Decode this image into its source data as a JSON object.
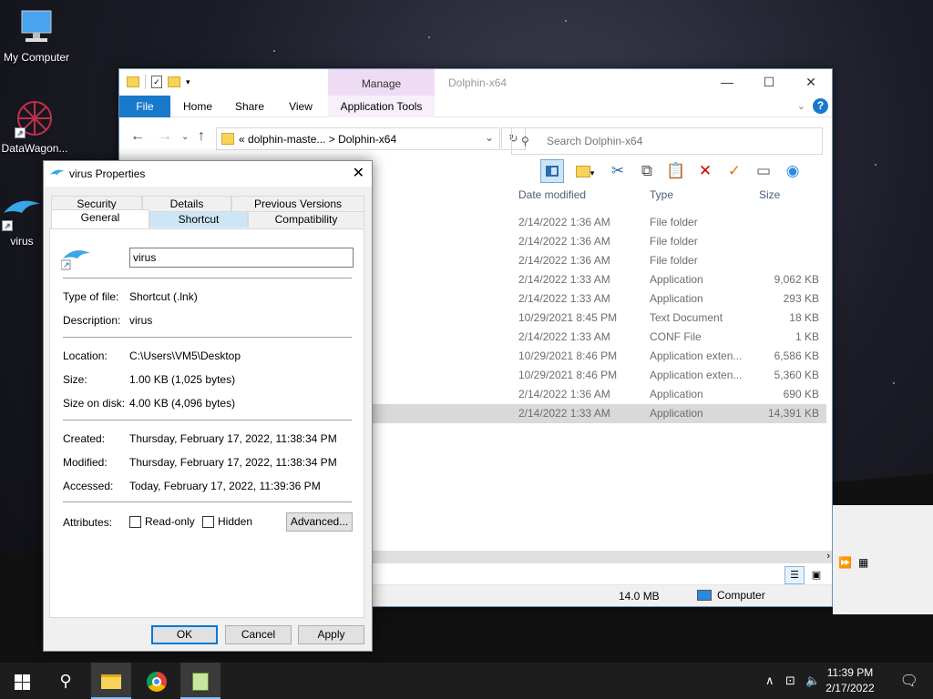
{
  "desktop": {
    "icons": [
      {
        "label": "My Computer",
        "icon": "computer-icon"
      },
      {
        "label": "DataWagon...",
        "icon": "datawagon-icon"
      },
      {
        "label": "virus",
        "icon": "dolphin-icon"
      }
    ]
  },
  "explorer": {
    "title": "Dolphin-x64",
    "manage_tab": "Manage",
    "ribbon_tabs": [
      "File",
      "Home",
      "Share",
      "View",
      "Application Tools"
    ],
    "address_path": "dolphin-maste...  >  Dolphin-x64",
    "address_prefix": "«",
    "search_placeholder": "Search Dolphin-x64",
    "columns": [
      "Date modified",
      "Type",
      "Size"
    ],
    "rows": [
      {
        "date": "2/14/2022 1:36 AM",
        "type": "File folder",
        "size": ""
      },
      {
        "date": "2/14/2022 1:36 AM",
        "type": "File folder",
        "size": ""
      },
      {
        "date": "2/14/2022 1:36 AM",
        "type": "File folder",
        "size": ""
      },
      {
        "date": "2/14/2022 1:33 AM",
        "type": "Application",
        "size": "9,062 KB"
      },
      {
        "date": "2/14/2022 1:33 AM",
        "type": "Application",
        "size": "293 KB"
      },
      {
        "date": "10/29/2021 8:45 PM",
        "type": "Text Document",
        "size": "18 KB"
      },
      {
        "date": "2/14/2022 1:33 AM",
        "type": "CONF File",
        "size": "1 KB"
      },
      {
        "date": "10/29/2021 8:46 PM",
        "type": "Application exten...",
        "size": "6,586 KB"
      },
      {
        "date": "10/29/2021 8:46 PM",
        "type": "Application exten...",
        "size": "5,360 KB"
      },
      {
        "date": "2/14/2022 1:36 AM",
        "type": "Application",
        "size": "690 KB"
      },
      {
        "date": "2/14/2022 1:33 AM",
        "type": "Application",
        "size": "14,391 KB"
      }
    ],
    "selected_row": 10,
    "status_size": "14.0 MB",
    "status_zone": "Computer"
  },
  "dialog": {
    "title": "virus Properties",
    "tabs_top": [
      "Security",
      "Details",
      "Previous Versions"
    ],
    "tabs_bottom": [
      "General",
      "Shortcut",
      "Compatibility"
    ],
    "name_value": "virus",
    "type_label": "Type of file:",
    "type_value": "Shortcut (.lnk)",
    "desc_label": "Description:",
    "desc_value": "virus",
    "location_label": "Location:",
    "location_value": "C:\\Users\\VM5\\Desktop",
    "size_label": "Size:",
    "size_value": "1.00 KB (1,025 bytes)",
    "sizedisk_label": "Size on disk:",
    "sizedisk_value": "4.00 KB (4,096 bytes)",
    "created_label": "Created:",
    "created_value": "Thursday, February 17, 2022, 11:38:34 PM",
    "modified_label": "Modified:",
    "modified_value": "Thursday, February 17, 2022, 11:38:34 PM",
    "accessed_label": "Accessed:",
    "accessed_value": "Today, February 17, 2022, 11:39:36 PM",
    "attributes_label": "Attributes:",
    "readonly_label": "Read-only",
    "hidden_label": "Hidden",
    "advanced_label": "Advanced...",
    "ok_label": "OK",
    "cancel_label": "Cancel",
    "apply_label": "Apply"
  },
  "taskbar": {
    "time": "11:39 PM",
    "date": "2/17/2022"
  }
}
